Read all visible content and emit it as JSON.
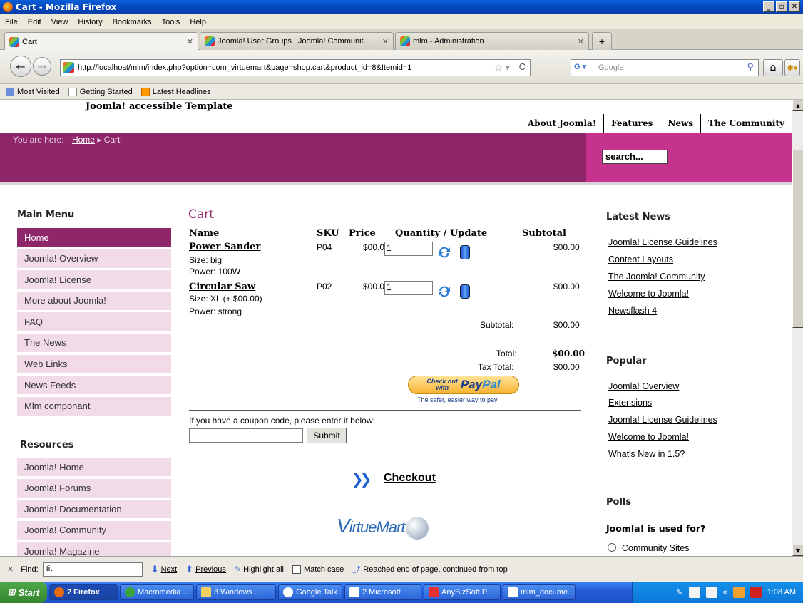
{
  "window": {
    "title": "Cart - Mozilla Firefox"
  },
  "menubar": [
    "File",
    "Edit",
    "View",
    "History",
    "Bookmarks",
    "Tools",
    "Help"
  ],
  "tabs": [
    {
      "label": "Cart",
      "active": true
    },
    {
      "label": "Joomla! User Groups | Joomla! Communit...",
      "active": false
    },
    {
      "label": "mlm - Administration",
      "active": false
    }
  ],
  "new_tab": "+",
  "url": "http://localhost/mlm/index.php?option=com_virtuemart&page=shop.cart&product_id=8&Itemid=1",
  "browser_search_placeholder": "Google",
  "bookmarks": [
    "Most Visited",
    "Getting Started",
    "Latest Headlines"
  ],
  "site": {
    "template_title": "Joomla! accessible Template",
    "topnav": [
      "About Joomla!",
      "Features",
      "News",
      "The Community"
    ],
    "breadcrumb": {
      "prefix": "You are here:",
      "home": "Home",
      "separator": "▸",
      "current": "Cart"
    },
    "search_value": "search..."
  },
  "main_menu": {
    "title": "Main Menu",
    "items": [
      "Home",
      "Joomla! Overview",
      "Joomla! License",
      "More about Joomla!",
      "FAQ",
      "The News",
      "Web Links",
      "News Feeds",
      "Mlm componant"
    ]
  },
  "resources": {
    "title": "Resources",
    "items": [
      "Joomla! Home",
      "Joomla! Forums",
      "Joomla! Documentation",
      "Joomla! Community",
      "Joomla! Magazine"
    ]
  },
  "cart": {
    "title": "Cart",
    "headers": {
      "name": "Name",
      "sku": "SKU",
      "price": "Price",
      "qty": "Quantity / Update",
      "subtotal": "Subtotal"
    },
    "products": [
      {
        "name": "Power Sander",
        "attrs": [
          "Size: big",
          "Power: 100W"
        ],
        "sku": "P04",
        "price": "$00.00",
        "qty": "1",
        "subtotal": "$00.00"
      },
      {
        "name": "Circular Saw",
        "attrs": [
          "Size: XL (+ $00.00)",
          "Power: strong"
        ],
        "sku": "P02",
        "price": "$00.00",
        "qty": "1",
        "subtotal": "$00.00"
      }
    ],
    "subtotal_label": "Subtotal:",
    "subtotal_value": "$00.00",
    "total_label": "Total:",
    "total_value": "$00.00",
    "tax_label": "Tax Total:",
    "tax_value": "$00.00",
    "paypal": {
      "checkout": "Check out",
      "with": "with",
      "brand_a": "Pay",
      "brand_b": "Pal",
      "tagline": "The safer, easier way to pay"
    },
    "coupon_prompt": "If you have a coupon code, please enter it below:",
    "submit_label": "Submit",
    "checkout_label": "Checkout",
    "virtuemart_logo": {
      "v": "V",
      "rest": "irtueMart"
    }
  },
  "latest_news": {
    "title": "Latest News",
    "items": [
      "Joomla! License Guidelines",
      "Content Layouts",
      "The Joomla! Community",
      "Welcome to Joomla!",
      "Newsflash 4"
    ]
  },
  "popular": {
    "title": "Popular",
    "items": [
      "Joomla! Overview",
      "Extensions",
      "Joomla! License Guidelines",
      "Welcome to Joomla!",
      "What's New in 1.5?"
    ]
  },
  "polls": {
    "title": "Polls",
    "question": "Joomla! is used for?",
    "options": [
      "Community Sites"
    ]
  },
  "findbar": {
    "label": "Find:",
    "value": "tit",
    "next": "Next",
    "previous": "Previous",
    "highlight": "Highlight all",
    "matchcase": "Match case",
    "status": "Reached end of page, continued from top"
  },
  "taskbar": {
    "start": "Start",
    "items": [
      "2 Firefox",
      "Macromedia ...",
      "3 Windows ...",
      "Google Talk",
      "2 Microsoft ...",
      "AnyBizSoft P...",
      "mlm_docume..."
    ],
    "clock": "1:08 AM"
  }
}
